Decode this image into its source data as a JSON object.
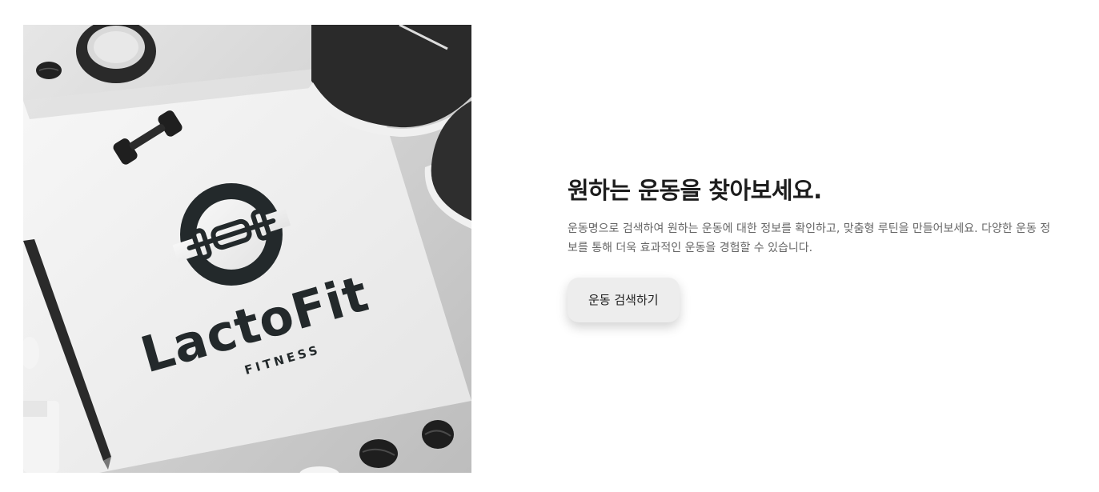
{
  "hero": {
    "brand_name": "LactoFit",
    "brand_tagline": "FITNESS"
  },
  "section": {
    "title": "원하는 운동을 찾아보세요.",
    "description": "운동명으로 검색하여 원하는 운동에 대한 정보를 확인하고, 맞춤형 루틴을 만들어보세요. 다양한 운동 정보를 통해 더욱 효과적인 운동을 경험할 수 있습니다.",
    "cta_label": "운동 검색하기"
  },
  "colors": {
    "title": "#1d1d1d",
    "description": "#666666",
    "button_bg": "#ededed",
    "logo_dark": "#23292b"
  },
  "icons": [
    "dumbbell-icon",
    "logo-barbell-icon"
  ]
}
